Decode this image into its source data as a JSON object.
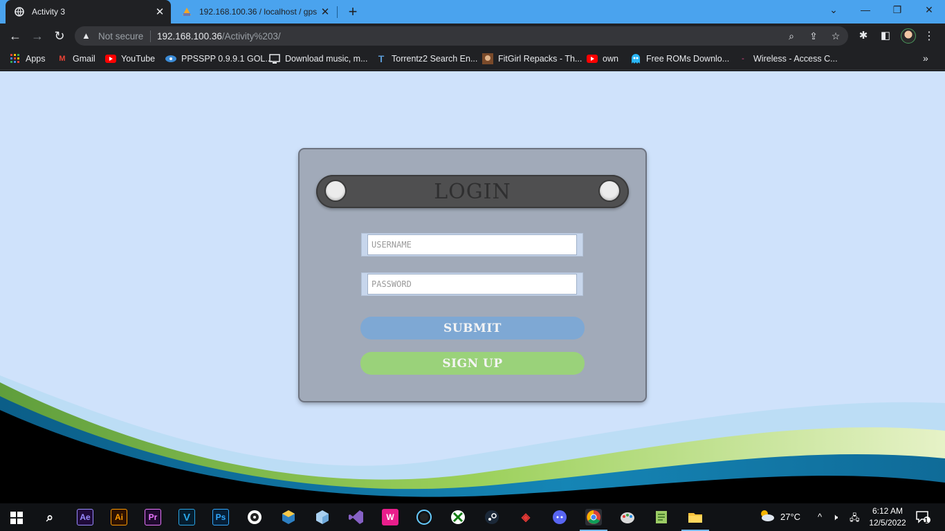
{
  "browser": {
    "tabs": [
      {
        "title": "Activity 3",
        "icon": "globe-icon",
        "active": true
      },
      {
        "title": "192.168.100.36 / localhost / gps_",
        "icon": "phpmyadmin-icon",
        "active": false
      }
    ],
    "address": {
      "security_label": "Not secure",
      "host": "192.168.100.36",
      "path": "/Activity%203/"
    },
    "bookmarks": [
      {
        "label": "Apps",
        "icon": "apps-grid-icon"
      },
      {
        "label": "Gmail",
        "icon": "gmail-icon"
      },
      {
        "label": "YouTube",
        "icon": "youtube-icon"
      },
      {
        "label": "PPSSPP 0.9.9.1 GOL...",
        "icon": "ppsspp-icon"
      },
      {
        "label": "Download music, m...",
        "icon": "music-icon"
      },
      {
        "label": "Torrentz2 Search En...",
        "icon": "torrentz-icon"
      },
      {
        "label": "FitGirl Repacks - Th...",
        "icon": "fitgirl-icon"
      },
      {
        "label": "own",
        "icon": "youtube-icon"
      },
      {
        "label": "Free ROMs Downlo...",
        "icon": "ghost-icon"
      },
      {
        "label": "Wireless - Access C...",
        "icon": "wireless-icon"
      }
    ]
  },
  "login": {
    "title": "LOGIN",
    "username_placeholder": "USERNAME",
    "password_placeholder": "PASSWORD",
    "submit_label": "SUBMIT",
    "signup_label": "SIGN UP"
  },
  "taskbar": {
    "apps": [
      {
        "label": "Ae",
        "icon": "after-effects-icon"
      },
      {
        "label": "Ai",
        "icon": "illustrator-icon"
      },
      {
        "label": "Pr",
        "icon": "premiere-icon"
      },
      {
        "label": "V",
        "icon": "vegas-icon"
      },
      {
        "label": "Ps",
        "icon": "photoshop-icon"
      }
    ],
    "weather": "27°C",
    "time": "6:12 AM",
    "date": "12/5/2022",
    "notifications": "1"
  },
  "colors": {
    "page_bg": "#cfe2fb",
    "card_bg": "#a1aab9",
    "banner_bg": "#4f4f50",
    "submit_bg": "#7ea8d4",
    "signup_bg": "#9ad27a"
  }
}
